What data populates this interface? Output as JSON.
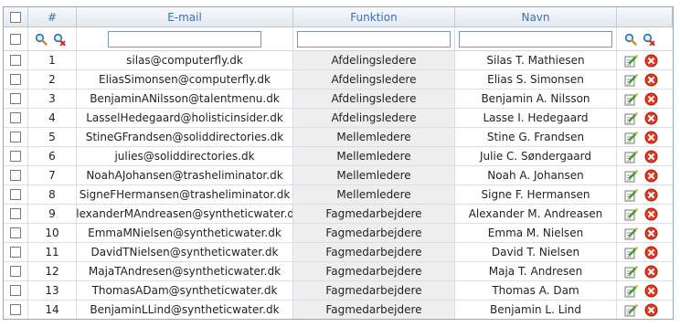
{
  "columns": {
    "number": "#",
    "email": "E-mail",
    "function": "Funktion",
    "name": "Navn"
  },
  "filters": {
    "email": "",
    "function": "",
    "name": ""
  },
  "icons": {
    "search": "search-icon",
    "clear_filter": "clear-filter-icon",
    "edit": "edit-icon",
    "delete": "delete-icon"
  },
  "rows": [
    {
      "num": "1",
      "email": "silas@computerfly.dk",
      "function": "Afdelingsledere",
      "name": "Silas T. Mathiesen"
    },
    {
      "num": "2",
      "email": "EliasSimonsen@computerfly.dk",
      "function": "Afdelingsledere",
      "name": "Elias S. Simonsen"
    },
    {
      "num": "3",
      "email": "BenjaminANilsson@talentmenu.dk",
      "function": "Afdelingsledere",
      "name": "Benjamin A. Nilsson"
    },
    {
      "num": "4",
      "email": "LasselHedegaard@holisticinsider.dk",
      "function": "Afdelingsledere",
      "name": "Lasse I. Hedegaard"
    },
    {
      "num": "5",
      "email": "StineGFrandsen@soliddirectories.dk",
      "function": "Mellemledere",
      "name": "Stine G. Frandsen"
    },
    {
      "num": "6",
      "email": "julies@soliddirectories.dk",
      "function": "Mellemledere",
      "name": "Julie C. Søndergaard"
    },
    {
      "num": "7",
      "email": "NoahAJohansen@trasheliminator.dk",
      "function": "Mellemledere",
      "name": "Noah A. Johansen"
    },
    {
      "num": "8",
      "email": "SigneFHermansen@trasheliminator.dk",
      "function": "Mellemledere",
      "name": "Signe F. Hermansen"
    },
    {
      "num": "9",
      "email": "AlexanderMAndreasen@syntheticwater.dk",
      "function": "Fagmedarbejdere",
      "name": "Alexander M. Andreasen"
    },
    {
      "num": "10",
      "email": "EmmaMNielsen@syntheticwater.dk",
      "function": "Fagmedarbejdere",
      "name": "Emma M. Nielsen"
    },
    {
      "num": "11",
      "email": "DavidTNielsen@syntheticwater.dk",
      "function": "Fagmedarbejdere",
      "name": "David T. Nielsen"
    },
    {
      "num": "12",
      "email": "MajaTAndresen@syntheticwater.dk",
      "function": "Fagmedarbejdere",
      "name": "Maja T. Andresen"
    },
    {
      "num": "13",
      "email": "ThomasADam@syntheticwater.dk",
      "function": "Fagmedarbejdere",
      "name": "Thomas A. Dam"
    },
    {
      "num": "14",
      "email": "BenjaminLLind@syntheticwater.dk",
      "function": "Fagmedarbejdere",
      "name": "Benjamin L. Lind"
    }
  ]
}
